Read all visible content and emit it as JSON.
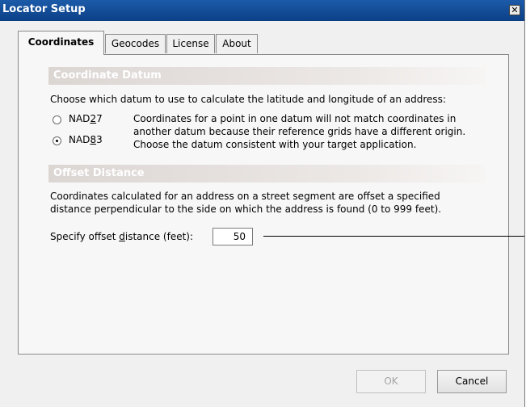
{
  "window": {
    "title": "Locator Setup",
    "close_glyph": "✕"
  },
  "tabs": [
    {
      "label": "Coordinates",
      "active": true
    },
    {
      "label": "Geocodes",
      "active": false
    },
    {
      "label": "License",
      "active": false
    },
    {
      "label": "About",
      "active": false
    }
  ],
  "datum": {
    "header": "Coordinate Datum",
    "instruction": "Choose which datum to use to calculate the latitude and longitude of an address:",
    "options": [
      {
        "label_pre": "NAD",
        "label_mnemonic": "2",
        "label_post": "7",
        "selected": false
      },
      {
        "label_pre": "NAD",
        "label_mnemonic": "8",
        "label_post": "3",
        "selected": true
      }
    ],
    "explanation": [
      "Coordinates for a point in one datum will not match coordinates in",
      "another datum because their reference grids have a different origin.",
      "Choose the datum consistent with your target application."
    ]
  },
  "offset": {
    "header": "Offset Distance",
    "description": [
      "Coordinates calculated for an address on a street segment are offset a specified",
      "distance perpendicular to the side on which the address is found (0 to 999 feet)."
    ],
    "label_pre": "Specify offset ",
    "label_mnemonic": "d",
    "label_post": "istance (feet):",
    "value": "50"
  },
  "buttons": {
    "ok": "OK",
    "cancel": "Cancel",
    "ok_enabled": false
  },
  "colors": {
    "titlebar": "#0b3f86",
    "header_gradient": "#dcd6d3"
  }
}
